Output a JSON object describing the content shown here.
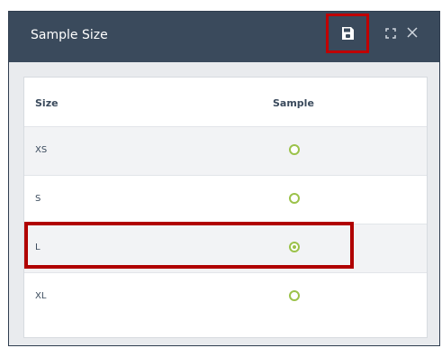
{
  "window": {
    "title": "Sample Size"
  },
  "icons": {
    "save": "save-icon",
    "expand": "expand-icon",
    "close": "close-icon"
  },
  "table": {
    "headers": [
      "Size",
      "Sample"
    ],
    "rows": [
      {
        "size": "XS",
        "selected": false
      },
      {
        "size": "S",
        "selected": false
      },
      {
        "size": "L",
        "selected": true
      },
      {
        "size": "XL",
        "selected": false
      }
    ]
  },
  "colors": {
    "header": "#3a4a5c",
    "accent": "#9bc24a",
    "highlight": "#b00000"
  }
}
